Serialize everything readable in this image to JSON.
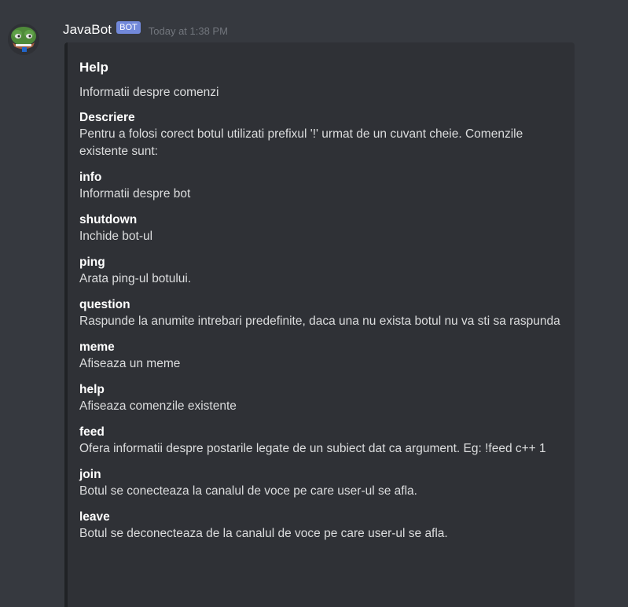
{
  "message": {
    "username": "JavaBot",
    "bot_tag": "BOT",
    "timestamp": "Today at 1:38 PM",
    "avatar_icon": "pepe-frog-avatar"
  },
  "embed": {
    "title": "Help",
    "description": "Informatii despre comenzi",
    "fields": [
      {
        "name": "Descriere",
        "value": "Pentru a folosi corect botul utilizati prefixul '!' urmat de un cuvant cheie. Comenzile existente sunt:"
      },
      {
        "name": "info",
        "value": "Informatii despre bot"
      },
      {
        "name": "shutdown",
        "value": "Inchide bot-ul"
      },
      {
        "name": "ping",
        "value": "Arata ping-ul botului."
      },
      {
        "name": "question",
        "value": "Raspunde la anumite intrebari predefinite, daca una nu exista botul nu va sti sa raspunda"
      },
      {
        "name": "meme",
        "value": "Afiseaza un meme"
      },
      {
        "name": "help",
        "value": "Afiseaza comenzile existente"
      },
      {
        "name": "feed",
        "value": "Ofera informatii despre postarile legate de un subiect dat ca argument. Eg: !feed c++ 1"
      },
      {
        "name": "join",
        "value": "Botul se conecteaza la canalul de voce pe care user-ul se afla."
      },
      {
        "name": "leave",
        "value": "Botul se deconecteaza de la canalul de voce pe care user-ul se afla."
      }
    ]
  },
  "colors": {
    "background": "#36393f",
    "embed_background": "#2f3136",
    "bot_tag": "#7289da",
    "timestamp": "#72767d"
  }
}
